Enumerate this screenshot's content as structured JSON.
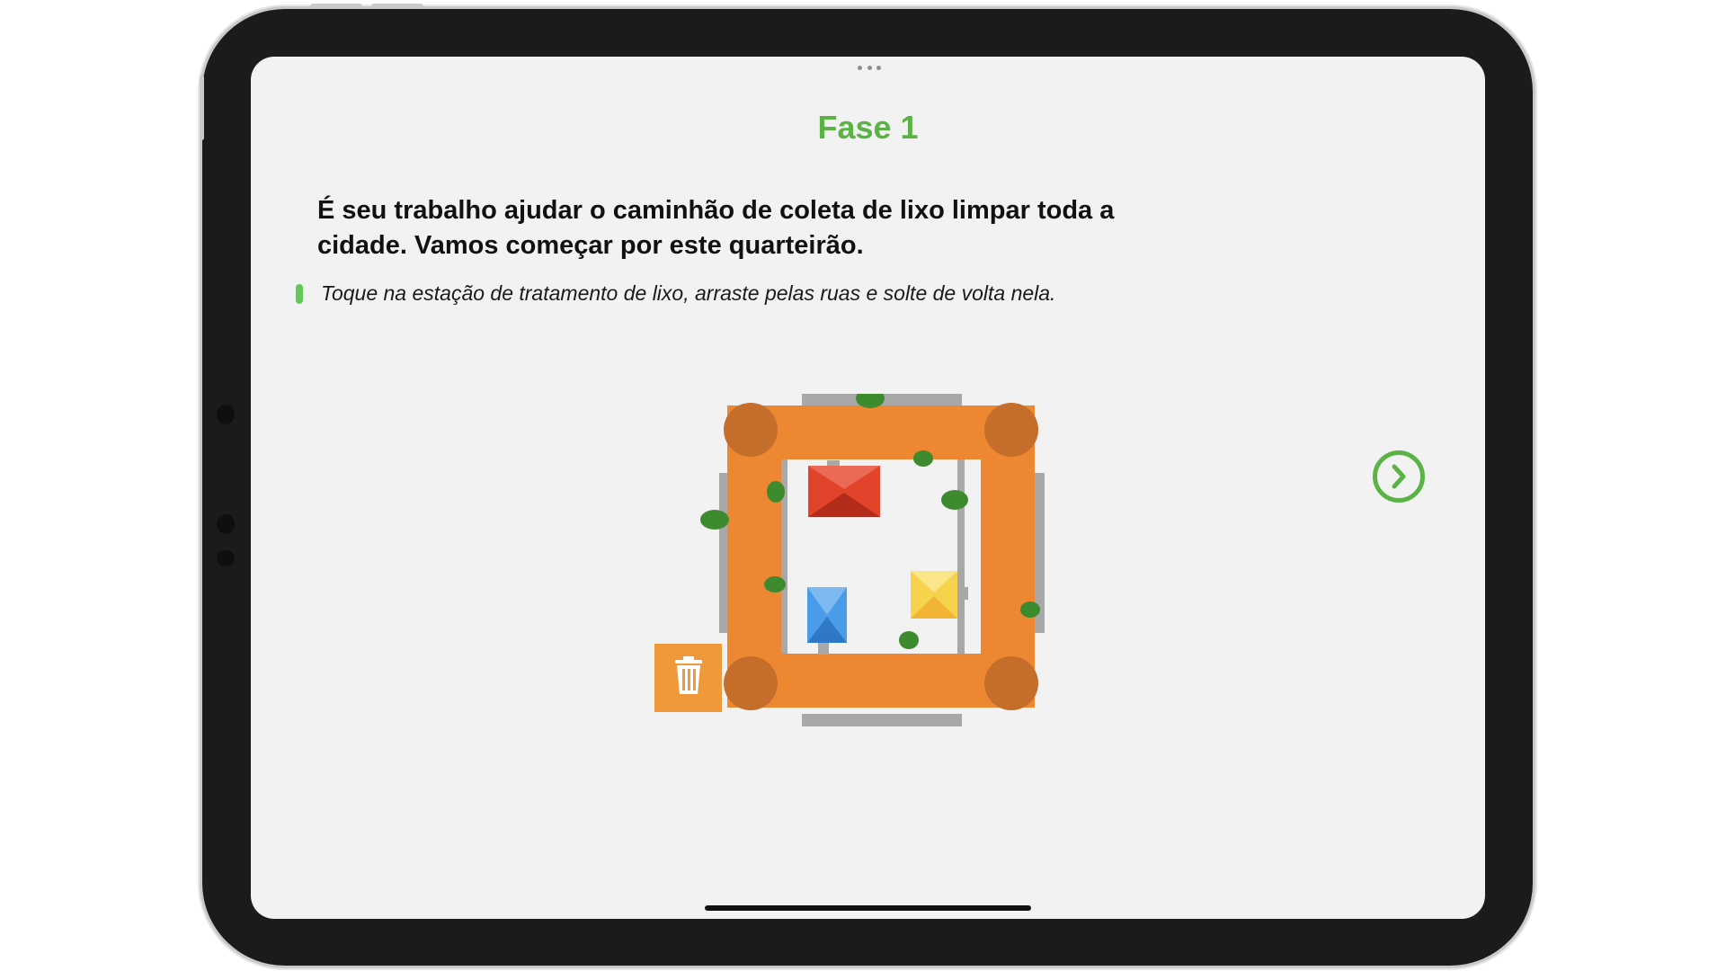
{
  "screen": {
    "title": "Fase 1",
    "lead": "É seu trabalho ajudar o caminhão de coleta de lixo limpar toda a cidade. Vamos começar por este quarteirão.",
    "instruction": "Toque na estação de tratamento de lixo, arraste pelas ruas e solte de volta nela."
  },
  "controls": {
    "next_icon": "chevron-right-circle-icon",
    "grabber_icon": "ellipsis-icon",
    "trash_icon": "trash-icon"
  },
  "colors": {
    "title": "#5bb346",
    "road": "#ee8732",
    "intersection": "#c56e2b",
    "sidewalk": "#a8a8a8",
    "trash_station": "#ef9a3a",
    "house_red": "#e2442b",
    "house_yellow": "#f6d24d",
    "house_blue": "#4a9be8",
    "litter": "#3d8b2e"
  }
}
